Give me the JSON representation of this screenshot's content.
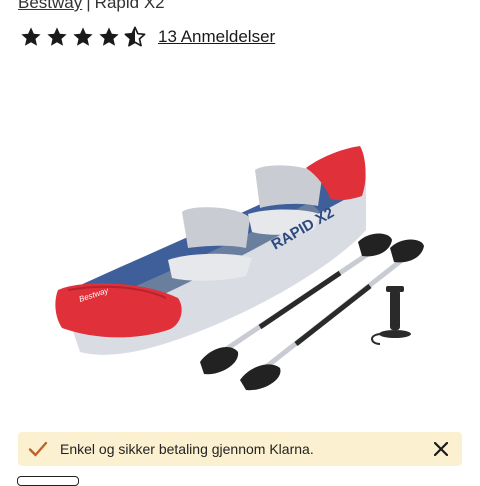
{
  "breadcrumb": {
    "brand": "Bestway",
    "separator": "|",
    "product": "Rapid X2"
  },
  "rating": {
    "value": 4.5,
    "max": 5,
    "reviews_label": "13 Anmeldelser"
  },
  "product_image": {
    "description_icon": "inflatable-kayak-image",
    "hull_print": "RAPID X2",
    "brand_print": "Bestway"
  },
  "notice": {
    "text": "Enkel og sikker betaling gjennom Klarna.",
    "icon": "check-icon",
    "close_icon": "close-icon",
    "accent": "#c0612b",
    "background": "#fbf1d0"
  },
  "colors": {
    "kayak_red": "#e0303a",
    "kayak_blue": "#3f5f9a",
    "kayak_grey": "#d9dce3"
  }
}
